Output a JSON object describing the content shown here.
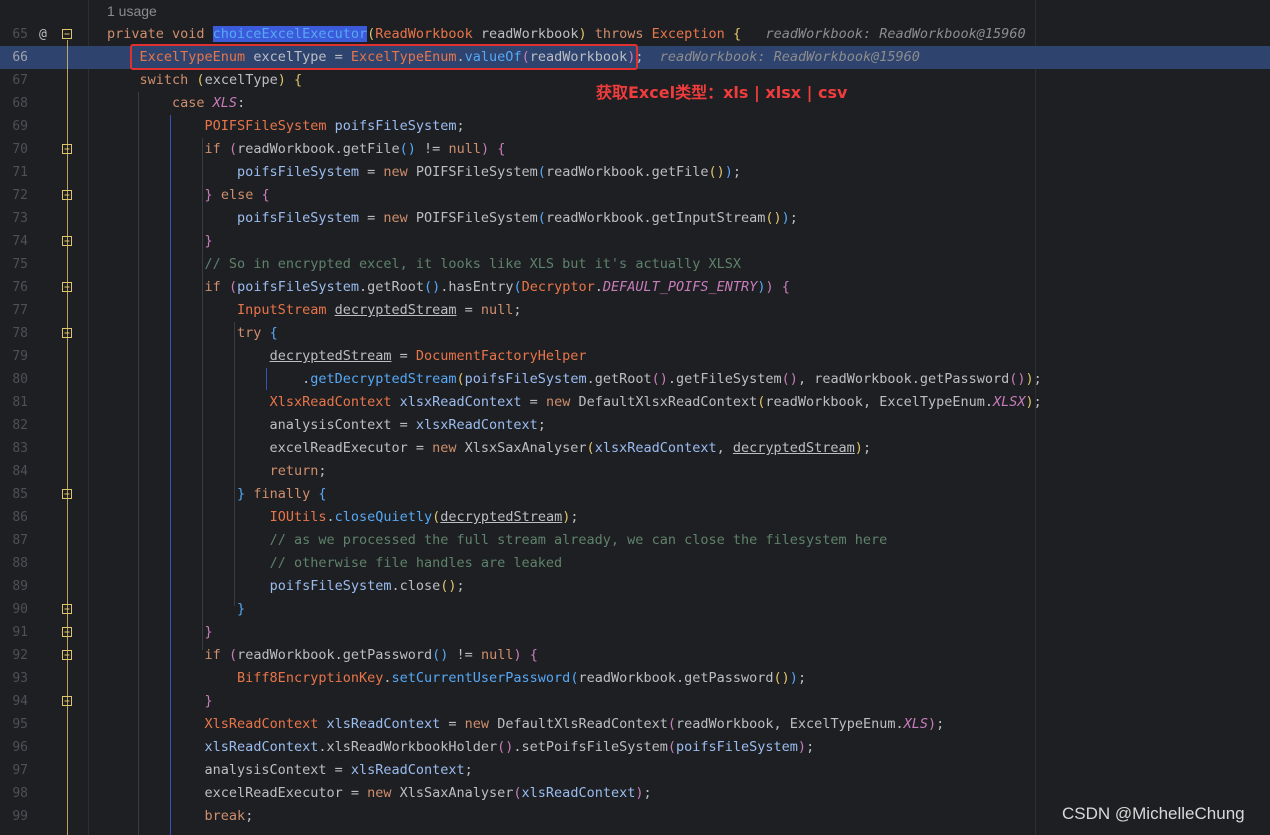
{
  "usage_hint": "1 usage",
  "annotation": "获取Excel类型：xls | xlsx | csv",
  "watermark": "CSDN @MichelleChung",
  "gutter_marker": "@",
  "colors": {
    "background": "#1e1f22",
    "execution_line": "#2e436e",
    "annotation_red": "#f03c3c"
  },
  "lines": [
    {
      "n": "65",
      "html": "<span class=\"kw\">private void </span><span class=\"fn sel\">choiceExcelExecutor</span><span class=\"brk1\">(</span><span class=\"tyr\">ReadWorkbook</span> readWorkbook<span class=\"brk1\">)</span> <span class=\"kw\">throws </span><span class=\"tyr\">Exception</span> <span class=\"brk1\">{</span>   <span class=\"hint\">readWorkbook: ReadWorkbook@15960</span>"
    },
    {
      "n": "66",
      "html": "    <span class=\"tyr\">ExcelTypeEnum</span> excelType = <span class=\"tyr\">ExcelTypeEnum</span>.<span class=\"fn\">valueOf</span><span class=\"brk2\">(</span>readWorkbook<span class=\"brk2\">)</span>;  <span class=\"hint\">readWorkbook: ReadWorkbook@15960</span>"
    },
    {
      "n": "67",
      "html": "    <span class=\"kw\">switch </span><span class=\"brk1\">(</span>excelType<span class=\"brk1\">)</span> <span class=\"brk1\">{</span>"
    },
    {
      "n": "68",
      "html": "        <span class=\"kw\">case </span><span class=\"cst\">XLS</span>:"
    },
    {
      "n": "69",
      "html": "            <span class=\"tyr\">POIFSFileSystem</span> <span class=\"lvar\">poifsFileSystem</span>;"
    },
    {
      "n": "70",
      "html": "            <span class=\"kw\">if </span><span class=\"brk2\">(</span>readWorkbook.<span class=\"var\">getFile</span><span class=\"brk3\">()</span> != <span class=\"kw\">null</span><span class=\"brk2\">)</span> <span class=\"brk2\">{</span>"
    },
    {
      "n": "71",
      "html": "                <span class=\"lvar\">poifsFileSystem</span> = <span class=\"kw\">new </span>POIFSFileSystem<span class=\"brk3\">(</span>readWorkbook.getFile<span class=\"brk1\">()</span><span class=\"brk3\">)</span>;"
    },
    {
      "n": "72",
      "html": "            <span class=\"brk2\">}</span> <span class=\"kw\">else </span><span class=\"brk2\">{</span>"
    },
    {
      "n": "73",
      "html": "                <span class=\"lvar\">poifsFileSystem</span> = <span class=\"kw\">new </span>POIFSFileSystem<span class=\"brk3\">(</span>readWorkbook.getInputStream<span class=\"brk1\">()</span><span class=\"brk3\">)</span>;"
    },
    {
      "n": "74",
      "html": "            <span class=\"brk2\">}</span>"
    },
    {
      "n": "75",
      "html": "            <span class=\"cm2\">// So in encrypted excel, it looks like XLS but it's actually XLSX</span>"
    },
    {
      "n": "76",
      "html": "            <span class=\"kw\">if </span><span class=\"brk2\">(</span><span class=\"lvar\">poifsFileSystem</span>.getRoot<span class=\"brk3\">()</span>.hasEntry<span class=\"brk3\">(</span><span class=\"tyr\">Decryptor</span>.<span class=\"cst\">DEFAULT_POIFS_ENTRY</span><span class=\"brk3\">)</span><span class=\"brk2\">)</span> <span class=\"brk2\">{</span>"
    },
    {
      "n": "77",
      "html": "                <span class=\"tyr\">InputStream</span> <span class=\"und\">decryptedStream</span> = <span class=\"kw\">null</span>;"
    },
    {
      "n": "78",
      "html": "                <span class=\"kw\">try </span><span class=\"brk3\">{</span>"
    },
    {
      "n": "79",
      "html": "                    <span class=\"und\">decryptedStream</span> = <span class=\"tyr\">DocumentFactoryHelper</span>"
    },
    {
      "n": "80",
      "html": "                        .<span class=\"fn\">getDecryptedStream</span><span class=\"brk1\">(</span><span class=\"lvar\">poifsFileSystem</span>.getRoot<span class=\"brk2\">()</span>.getFileSystem<span class=\"brk2\">()</span>, readWorkbook.getPassword<span class=\"brk2\">()</span><span class=\"brk1\">)</span>;"
    },
    {
      "n": "81",
      "html": "                    <span class=\"tyr\">XlsxReadContext</span> <span class=\"lvar\">xlsxReadContext</span> = <span class=\"kw\">new </span>DefaultXlsxReadContext<span class=\"brk1\">(</span>readWorkbook, ExcelTypeEnum.<span class=\"cst\">XLSX</span><span class=\"brk1\">)</span>;"
    },
    {
      "n": "82",
      "html": "                    analysisContext = <span class=\"lvar\">xlsxReadContext</span>;"
    },
    {
      "n": "83",
      "html": "                    excelReadExecutor = <span class=\"kw\">new </span>XlsxSaxAnalyser<span class=\"brk1\">(</span><span class=\"lvar\">xlsxReadContext</span>, <span class=\"und\">decryptedStream</span><span class=\"brk1\">)</span>;"
    },
    {
      "n": "84",
      "html": "                    <span class=\"kw\">return</span>;"
    },
    {
      "n": "85",
      "html": "                <span class=\"brk3\">}</span> <span class=\"kw\">finally </span><span class=\"brk3\">{</span>"
    },
    {
      "n": "86",
      "html": "                    <span class=\"tyr\">IOUtils</span>.<span class=\"fn\">closeQuietly</span><span class=\"brk1\">(</span><span class=\"und\">decryptedStream</span><span class=\"brk1\">)</span>;"
    },
    {
      "n": "87",
      "html": "                    <span class=\"cm2\">// as we processed the full stream already, we can close the filesystem here</span>"
    },
    {
      "n": "88",
      "html": "                    <span class=\"cm2\">// otherwise file handles are leaked</span>"
    },
    {
      "n": "89",
      "html": "                    <span class=\"lvar\">poifsFileSystem</span>.close<span class=\"brk1\">()</span>;"
    },
    {
      "n": "90",
      "html": "                <span class=\"brk3\">}</span>"
    },
    {
      "n": "91",
      "html": "            <span class=\"brk2\">}</span>"
    },
    {
      "n": "92",
      "html": "            <span class=\"kw\">if </span><span class=\"brk2\">(</span>readWorkbook.getPassword<span class=\"brk3\">()</span> != <span class=\"kw\">null</span><span class=\"brk2\">)</span> <span class=\"brk2\">{</span>"
    },
    {
      "n": "93",
      "html": "                <span class=\"tyr\">Biff8EncryptionKey</span>.<span class=\"fn\">setCurrentUserPassword</span><span class=\"brk3\">(</span>readWorkbook.getPassword<span class=\"brk1\">()</span><span class=\"brk3\">)</span>;"
    },
    {
      "n": "94",
      "html": "            <span class=\"brk2\">}</span>"
    },
    {
      "n": "95",
      "html": "            <span class=\"tyr\">XlsReadContext</span> <span class=\"lvar\">xlsReadContext</span> = <span class=\"kw\">new </span>DefaultXlsReadContext<span class=\"brk2\">(</span>readWorkbook, ExcelTypeEnum.<span class=\"cst\">XLS</span><span class=\"brk2\">)</span>;"
    },
    {
      "n": "96",
      "html": "            <span class=\"lvar\">xlsReadContext</span>.xlsReadWorkbookHolder<span class=\"brk2\">()</span>.setPoifsFileSystem<span class=\"brk2\">(</span><span class=\"lvar\">poifsFileSystem</span><span class=\"brk2\">)</span>;"
    },
    {
      "n": "97",
      "html": "            analysisContext = <span class=\"lvar\">xlsReadContext</span>;"
    },
    {
      "n": "98",
      "html": "            excelReadExecutor = <span class=\"kw\">new </span>XlsSaxAnalyser<span class=\"brk2\">(</span><span class=\"lvar\">xlsReadContext</span><span class=\"brk2\">)</span>;"
    },
    {
      "n": "99",
      "html": "            <span class=\"kw\">break</span>;"
    }
  ]
}
